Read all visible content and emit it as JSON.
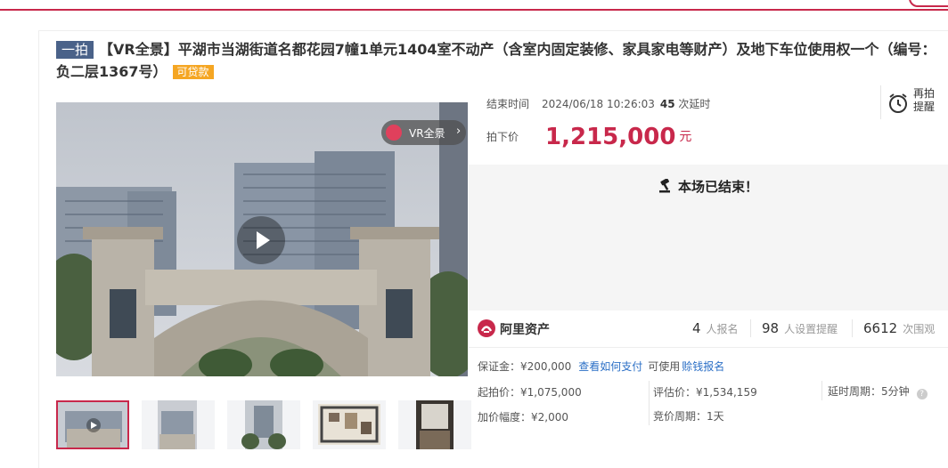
{
  "header": {
    "round_tag": "一拍",
    "title": "【VR全景】平湖市当湖街道名都花园7幢1单元1404室不动产（含室内固定装修、家具家电等财产）及地下车位使用权一个（编号：负二层1367号）",
    "loan_tag": "可贷款"
  },
  "gallery": {
    "vr_badge": "VR全景",
    "thumbnail_count": 5
  },
  "auction": {
    "end_time_label": "结束时间",
    "end_time": "2024/06/18 10:26:03",
    "delay_count": "45",
    "delay_label": "次延时",
    "remind_label_line1": "再拍",
    "remind_label_line2": "提醒",
    "final_price_label": "拍下价",
    "final_price": "1,215,000",
    "currency_unit": "元",
    "ended_text": "本场已结束！"
  },
  "stats": {
    "platform_name": "阿里资产",
    "signup_count": "4",
    "signup_label": "人报名",
    "remind_count": "98",
    "remind_label": "人设置提醒",
    "watch_count": "6612",
    "watch_label": "次围观"
  },
  "details": {
    "deposit": "保证金：¥200,000",
    "how_to_pay": "查看如何支付",
    "available_label": "可使用",
    "earn_link": "赊钱报名",
    "start_price": "起拍价：¥1,075,000",
    "appraisal": "评估价：¥1,534,159",
    "delay_period": "延时周期：5分钟",
    "increment": "加价幅度：¥2,000",
    "bid_period": "竞价周期：1天"
  },
  "colors": {
    "brand_red": "#c8284b",
    "link_blue": "#2b6fc6",
    "round_tag_bg": "#4a6289",
    "loan_tag_bg": "#f5a623"
  }
}
